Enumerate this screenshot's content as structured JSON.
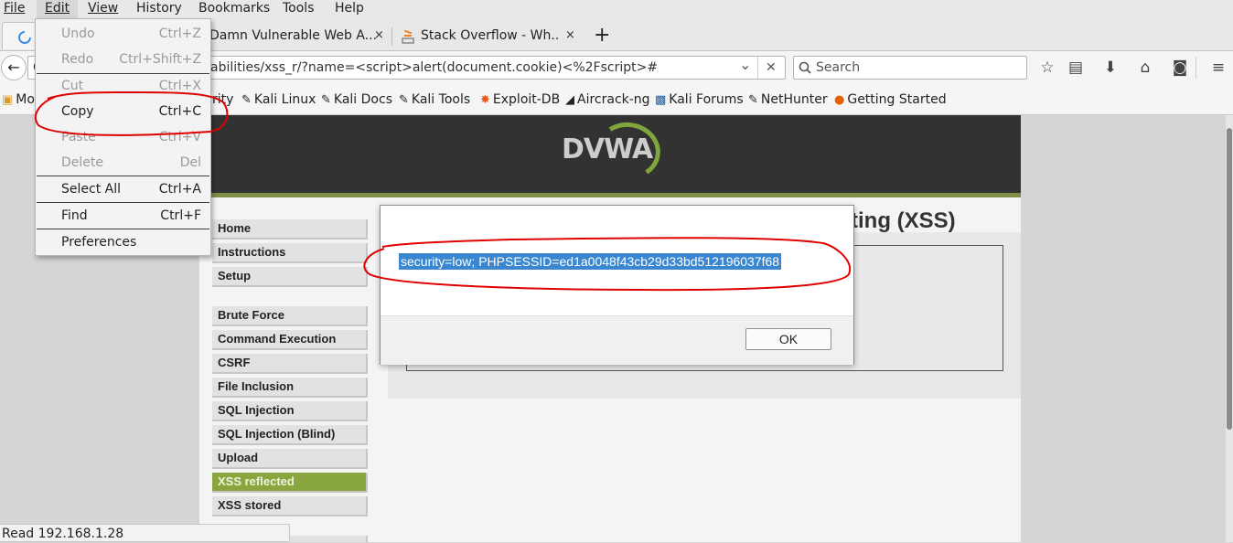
{
  "menubar": {
    "items": [
      "File",
      "Edit",
      "View",
      "History",
      "Bookmarks",
      "Tools",
      "Help"
    ]
  },
  "tabs": [
    {
      "title": "",
      "close": "×"
    },
    {
      "title": "Damn Vulnerable Web A...",
      "close": "×"
    },
    {
      "title": "Stack Overflow - Wh...",
      "close": "×"
    }
  ],
  "new_tab_label": "+",
  "address_bar": {
    "partial_left": "C",
    "url": "abilities/xss_r/?name=<script>alert(document.cookie)<%2Fscript>#",
    "dropdown": "⌄",
    "clear": "✕"
  },
  "search": {
    "placeholder": "Search"
  },
  "bookmarks": [
    {
      "label": "Mo",
      "icon": "folder-icon"
    },
    {
      "label": "rity",
      "icon": ""
    },
    {
      "label": "Kali Linux",
      "icon": "kali-dragon-icon"
    },
    {
      "label": "Kali Docs",
      "icon": "kali-dragon-icon"
    },
    {
      "label": "Kali Tools",
      "icon": "kali-dragon-icon"
    },
    {
      "label": "Exploit-DB",
      "icon": "exploit-db-icon"
    },
    {
      "label": "Aircrack-ng",
      "icon": "aircrack-icon"
    },
    {
      "label": "Kali Forums",
      "icon": "kali-forums-icon"
    },
    {
      "label": "NetHunter",
      "icon": "kali-dragon-icon"
    },
    {
      "label": "Getting Started",
      "icon": "firefox-icon"
    }
  ],
  "edit_menu": {
    "items": [
      {
        "label": "Undo",
        "shortcut": "Ctrl+Z",
        "enabled": false
      },
      {
        "label": "Redo",
        "shortcut": "Ctrl+Shift+Z",
        "enabled": false
      },
      {
        "label": "Cut",
        "shortcut": "Ctrl+X",
        "enabled": false
      },
      {
        "label": "Copy",
        "shortcut": "Ctrl+C",
        "enabled": true
      },
      {
        "label": "Paste",
        "shortcut": "Ctrl+V",
        "enabled": false
      },
      {
        "label": "Delete",
        "shortcut": "Del",
        "enabled": false
      },
      {
        "label": "Select All",
        "shortcut": "Ctrl+A",
        "enabled": true
      },
      {
        "label": "Find",
        "shortcut": "Ctrl+F",
        "enabled": true
      },
      {
        "label": "Preferences",
        "shortcut": "",
        "enabled": true
      }
    ]
  },
  "dvwa": {
    "logo": "DVWA",
    "page_title_partial": "ting (XSS)",
    "nav_group1": [
      "Home",
      "Instructions",
      "Setup"
    ],
    "nav_group2": [
      "Brute Force",
      "Command Execution",
      "CSRF",
      "File Inclusion",
      "SQL Injection",
      "SQL Injection (Blind)",
      "Upload",
      "XSS reflected",
      "XSS stored"
    ],
    "selected": "XSS reflected"
  },
  "alert_dialog": {
    "message": "security=low; PHPSESSID=ed1a0048f43cb29d33bd512196037f68",
    "ok_label": "OK"
  },
  "status_bar": {
    "text": "Read 192.168.1.28"
  },
  "colors": {
    "accent_selection": "#3a87d0",
    "dvwa_green": "#8aa63f",
    "annotation_red": "#e00000"
  }
}
